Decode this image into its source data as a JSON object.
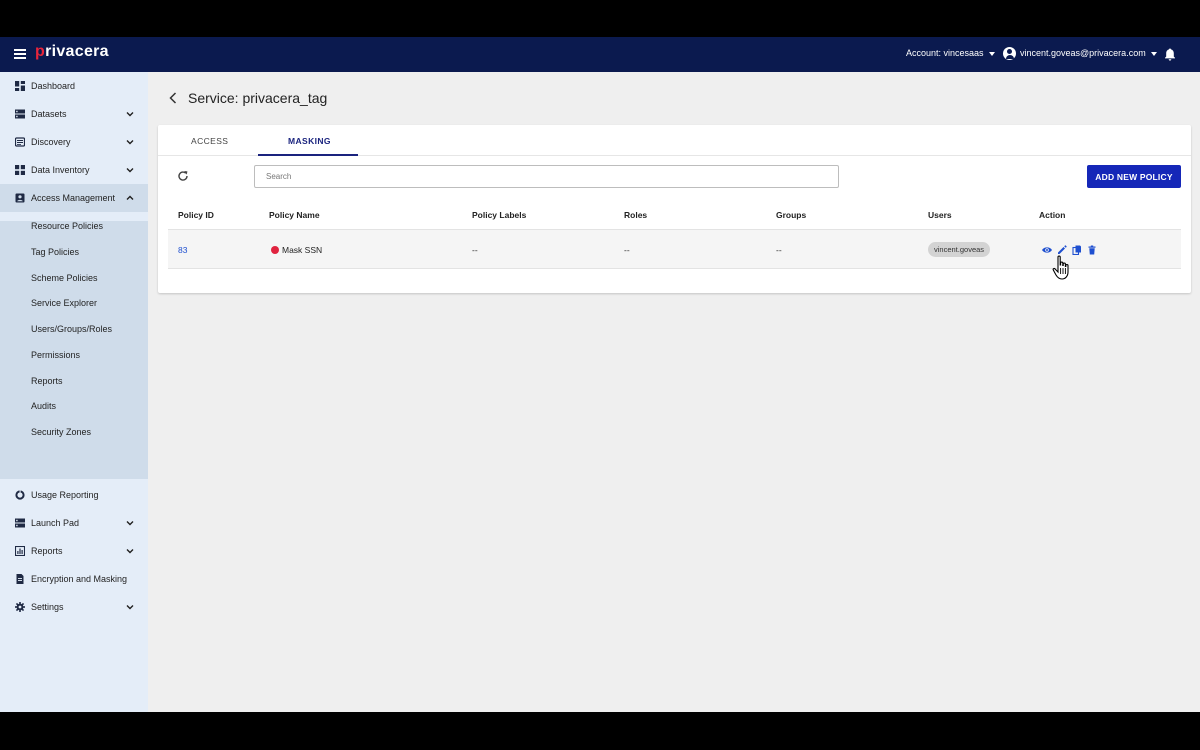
{
  "topbar": {
    "logo_prefix": "p",
    "logo_rest": "rivacera",
    "account_label": "Account: vincesaas",
    "user_email": "vincent.goveas@privacera.com"
  },
  "sidebar": {
    "items": [
      {
        "label": "Dashboard"
      },
      {
        "label": "Datasets"
      },
      {
        "label": "Discovery"
      },
      {
        "label": "Data Inventory"
      },
      {
        "label": "Access Management"
      },
      {
        "label": "Usage Reporting"
      },
      {
        "label": "Launch Pad"
      },
      {
        "label": "Reports"
      },
      {
        "label": "Encryption and Masking"
      },
      {
        "label": "Settings"
      }
    ],
    "sub_items": [
      {
        "label": "Resource Policies"
      },
      {
        "label": "Tag Policies"
      },
      {
        "label": "Scheme Policies"
      },
      {
        "label": "Service Explorer"
      },
      {
        "label": "Users/Groups/Roles"
      },
      {
        "label": "Permissions"
      },
      {
        "label": "Reports"
      },
      {
        "label": "Audits"
      },
      {
        "label": "Security Zones"
      }
    ]
  },
  "main": {
    "title": "Service: privacera_tag",
    "tabs": [
      {
        "label": "ACCESS"
      },
      {
        "label": "MASKING"
      }
    ],
    "active_tab": "MASKING",
    "search": {
      "placeholder": "Search",
      "value": ""
    },
    "add_button_label": "ADD NEW POLICY",
    "table": {
      "columns": [
        "Policy ID",
        "Policy Name",
        "Policy Labels",
        "Roles",
        "Groups",
        "Users",
        "Action"
      ],
      "rows": [
        {
          "policy_id": "83",
          "policy_name": "Mask SSN",
          "policy_labels": "--",
          "roles": "--",
          "groups": "--",
          "users": "vincent.goveas"
        }
      ]
    }
  },
  "colors": {
    "topbar": "#0b1a4f",
    "accent": "#1527b8",
    "status_dot": "#e0233f",
    "link": "#1e4fd0"
  },
  "icons": {
    "actions": [
      "eye-icon",
      "pencil-icon",
      "copy-icon",
      "trash-icon"
    ]
  }
}
